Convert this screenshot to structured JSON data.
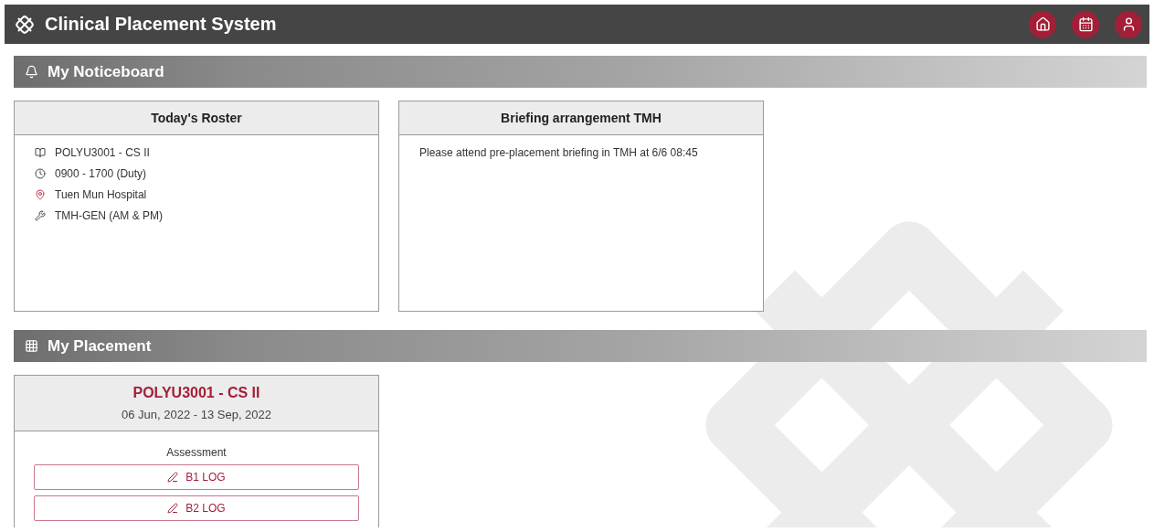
{
  "header": {
    "title": "Clinical Placement System",
    "actions": [
      {
        "kind": "home"
      },
      {
        "kind": "calendar"
      },
      {
        "kind": "user"
      }
    ]
  },
  "noticeboard": {
    "title": "My Noticeboard",
    "cards": [
      {
        "title": "Today's Roster",
        "kind": "list",
        "items": [
          {
            "kind": "course",
            "text": "POLYU3001 - CS II"
          },
          {
            "kind": "time",
            "text": "0900 - 1700 (Duty)"
          },
          {
            "kind": "location",
            "text": "Tuen Mun Hospital"
          },
          {
            "kind": "ward",
            "text": "TMH-GEN (AM & PM)"
          }
        ]
      },
      {
        "title": "Briefing arrangement TMH",
        "kind": "message",
        "text": "Please attend pre-placement briefing in TMH at 6/6 08:45"
      }
    ]
  },
  "placement": {
    "title": "My Placement",
    "cards": [
      {
        "course": "POLYU3001 - CS II",
        "dates": "06 Jun, 2022 - 13 Sep, 2022",
        "section": "Assessment",
        "buttons": [
          "B1 LOG",
          "B2 LOG"
        ]
      }
    ]
  }
}
